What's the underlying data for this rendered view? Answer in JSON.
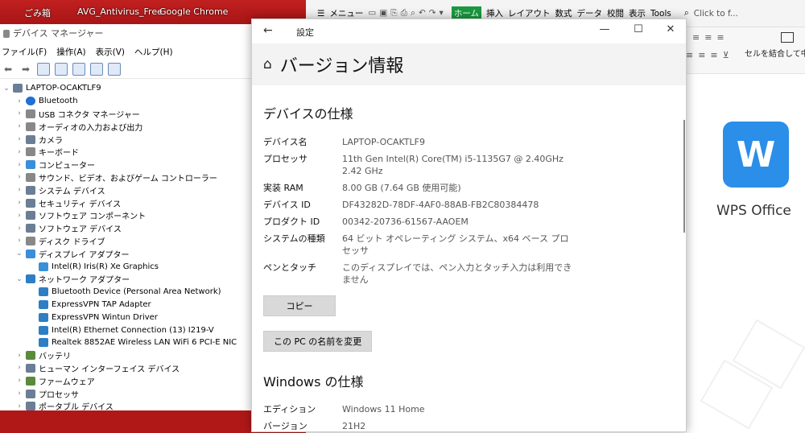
{
  "taskbar": {
    "items": [
      "ごみ箱",
      "AVG_Antivirus_Free",
      "Google Chrome"
    ]
  },
  "device_manager": {
    "title": "デバイス マネージャー",
    "menu": [
      "ファイル(F)",
      "操作(A)",
      "表示(V)",
      "ヘルプ(H)"
    ],
    "tree": [
      {
        "label": "LAPTOP-OCAKTLF9",
        "level": 0,
        "expand": "⌄",
        "icon": "computer-icon"
      },
      {
        "label": "Bluetooth",
        "level": 1,
        "expand": "›",
        "icon": "bluetooth-icon"
      },
      {
        "label": "USB コネクタ マネージャー",
        "level": 1,
        "expand": "›",
        "icon": "usb-icon"
      },
      {
        "label": "オーディオの入力および出力",
        "level": 1,
        "expand": "›",
        "icon": "speaker-icon"
      },
      {
        "label": "カメラ",
        "level": 1,
        "expand": "›",
        "icon": "camera-icon"
      },
      {
        "label": "キーボード",
        "level": 1,
        "expand": "›",
        "icon": "keyboard-icon"
      },
      {
        "label": "コンピューター",
        "level": 1,
        "expand": "›",
        "icon": "monitor-icon"
      },
      {
        "label": "サウンド、ビデオ、およびゲーム コントローラー",
        "level": 1,
        "expand": "›",
        "icon": "speaker-icon"
      },
      {
        "label": "システム デバイス",
        "level": 1,
        "expand": "›",
        "icon": "folder-icon"
      },
      {
        "label": "セキュリティ デバイス",
        "level": 1,
        "expand": "›",
        "icon": "security-icon"
      },
      {
        "label": "ソフトウェア コンポーネント",
        "level": 1,
        "expand": "›",
        "icon": "component-icon"
      },
      {
        "label": "ソフトウェア デバイス",
        "level": 1,
        "expand": "›",
        "icon": "device-icon"
      },
      {
        "label": "ディスク ドライブ",
        "level": 1,
        "expand": "›",
        "icon": "disk-icon"
      },
      {
        "label": "ディスプレイ アダプター",
        "level": 1,
        "expand": "⌄",
        "icon": "monitor-icon"
      },
      {
        "label": "Intel(R) Iris(R) Xe Graphics",
        "level": 2,
        "expand": "",
        "icon": "monitor-icon"
      },
      {
        "label": "ネットワーク アダプター",
        "level": 1,
        "expand": "⌄",
        "icon": "network-icon"
      },
      {
        "label": "Bluetooth Device (Personal Area Network)",
        "level": 2,
        "expand": "",
        "icon": "network-icon"
      },
      {
        "label": "ExpressVPN TAP Adapter",
        "level": 2,
        "expand": "",
        "icon": "network-icon"
      },
      {
        "label": "ExpressVPN Wintun Driver",
        "level": 2,
        "expand": "",
        "icon": "network-icon"
      },
      {
        "label": "Intel(R) Ethernet Connection (13) I219-V",
        "level": 2,
        "expand": "",
        "icon": "network-icon"
      },
      {
        "label": "Realtek 8852AE Wireless LAN WiFi 6 PCI-E NIC",
        "level": 2,
        "expand": "",
        "icon": "network-icon"
      },
      {
        "label": "バッテリ",
        "level": 1,
        "expand": "›",
        "icon": "battery-icon"
      },
      {
        "label": "ヒューマン インターフェイス デバイス",
        "level": 1,
        "expand": "›",
        "icon": "hid-icon"
      },
      {
        "label": "ファームウェア",
        "level": 1,
        "expand": "›",
        "icon": "firmware-icon"
      },
      {
        "label": "プロセッサ",
        "level": 1,
        "expand": "›",
        "icon": "processor-icon"
      },
      {
        "label": "ポータブル デバイス",
        "level": 1,
        "expand": "›",
        "icon": "portable-icon"
      }
    ]
  },
  "settings": {
    "title": "設定",
    "page_title": "バージョン情報",
    "device_spec": {
      "heading": "デバイスの仕様",
      "rows": [
        {
          "k": "デバイス名",
          "v": "LAPTOP-OCAKTLF9"
        },
        {
          "k": "プロセッサ",
          "v": "11th Gen Intel(R) Core(TM) i5-1135G7 @ 2.40GHz 2.42 GHz"
        },
        {
          "k": "実装 RAM",
          "v": "8.00 GB (7.64 GB 使用可能)"
        },
        {
          "k": "デバイス ID",
          "v": "DF43282D-78DF-4AF0-88AB-FB2C80384478"
        },
        {
          "k": "プロダクト ID",
          "v": "00342-20736-61567-AAOEM"
        },
        {
          "k": "システムの種類",
          "v": "64 ビット オペレーティング システム、x64 ベース プロセッサ"
        },
        {
          "k": "ペンとタッチ",
          "v": "このディスプレイでは、ペン入力とタッチ入力は利用できません"
        }
      ],
      "copy_button": "コピー",
      "rename_button": "この PC の名前を変更"
    },
    "windows_spec": {
      "heading": "Windows の仕様",
      "rows": [
        {
          "k": "エディション",
          "v": "Windows 11 Home"
        },
        {
          "k": "バージョン",
          "v": "21H2"
        }
      ]
    }
  },
  "wps": {
    "menu_label": "メニュー",
    "tabs": [
      "ホーム",
      "挿入",
      "レイアウト",
      "数式",
      "データ",
      "校閲",
      "表示",
      "Tools"
    ],
    "search_placeholder": "Click to f...",
    "merge_label": "セルを結合して中央",
    "logo_text": "W",
    "app_name": "WPS Office"
  },
  "colors": {
    "wps_blue": "#2b8ee8",
    "wps_green": "#1a9a3f",
    "desktop_red": "#b01818"
  }
}
